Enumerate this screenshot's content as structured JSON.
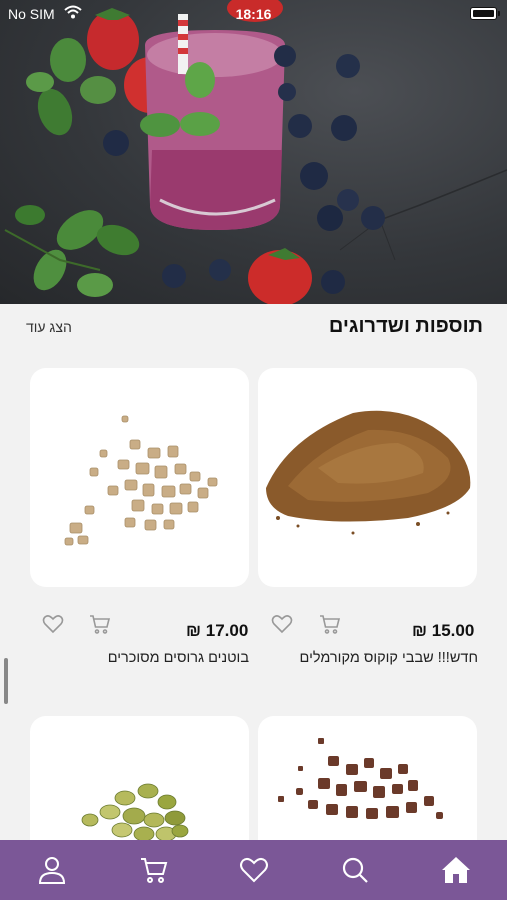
{
  "status_bar": {
    "carrier": "No SIM",
    "time": "18:16"
  },
  "section": {
    "title": "תוספות ושדרוגים",
    "show_more": "הצג עוד"
  },
  "products": [
    {
      "name": "חדש!!! שבבי קוקוס מקורמלים",
      "price": "₪ 15.00"
    },
    {
      "name": "בוטנים גרוסים מסוכרים",
      "price": "₪ 17.00"
    }
  ],
  "colors": {
    "nav_bg": "#7b5797",
    "background": "#f2f2f2"
  },
  "nav": [
    "home-icon",
    "search-icon",
    "heart-icon",
    "cart-icon",
    "user-icon"
  ]
}
